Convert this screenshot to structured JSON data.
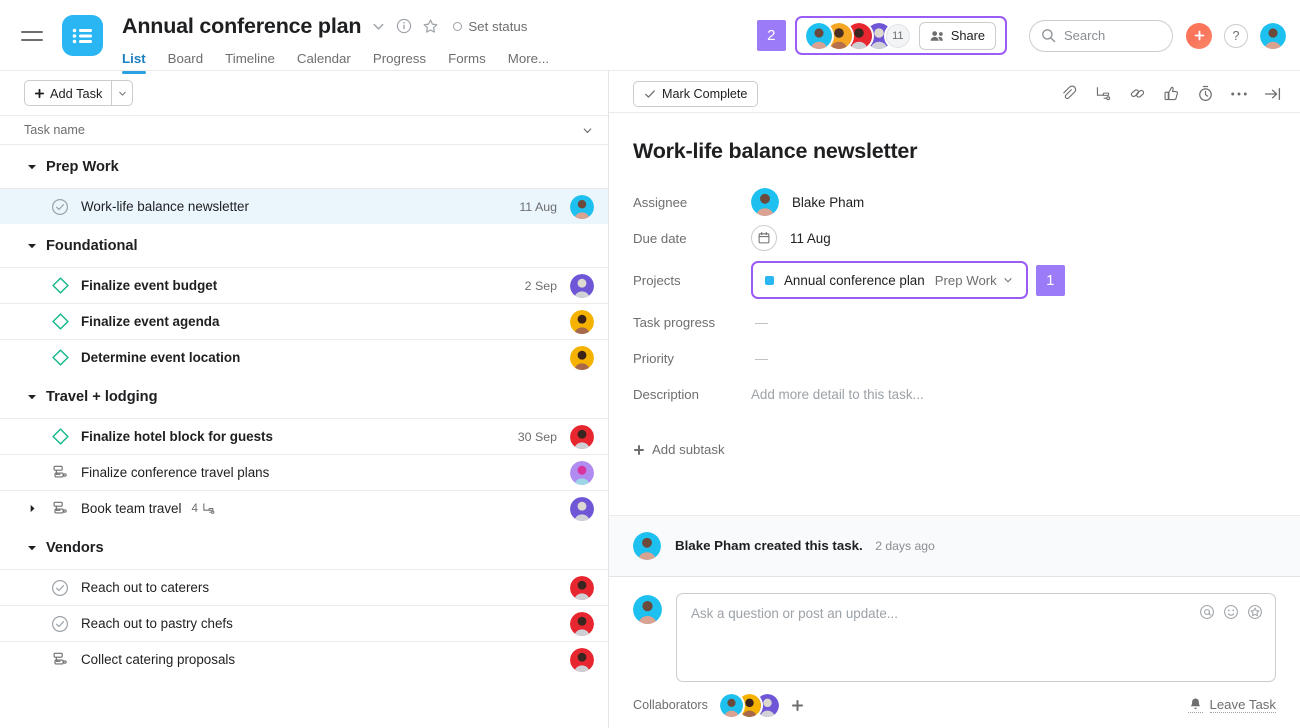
{
  "topbar": {
    "menu_icon": "hamburger-icon",
    "project_logo_icon": "project-list-logo-icon",
    "project_title": "Annual conference plan",
    "chevron_icon": "chevron-down-icon",
    "info_icon": "info-circle-icon",
    "star_icon": "star-outline-icon",
    "set_status_label": "Set status",
    "tabs": [
      {
        "label": "List",
        "active": true
      },
      {
        "label": "Board",
        "active": false
      },
      {
        "label": "Timeline",
        "active": false
      },
      {
        "label": "Calendar",
        "active": false
      },
      {
        "label": "Progress",
        "active": false
      },
      {
        "label": "Forms",
        "active": false
      },
      {
        "label": "More...",
        "active": false
      }
    ],
    "annotation_badge": "2",
    "members_overflow_count": "11",
    "share_label": "Share",
    "share_icon": "people-icon",
    "search_placeholder": "Search",
    "search_value": "",
    "search_icon": "search-icon",
    "plus_icon": "plus-icon",
    "help_label": "?",
    "avatars": [
      {
        "name": "member-1",
        "color": "#1ec0f0"
      },
      {
        "name": "member-2",
        "color": "#f5a623"
      },
      {
        "name": "member-3",
        "color": "#e8262f"
      },
      {
        "name": "member-4",
        "color": "#6f56d6"
      }
    ],
    "account_avatar_color": "#1ec0f0"
  },
  "list": {
    "add_task_label": "Add Task",
    "add_task_caret_icon": "chevron-down-icon",
    "column_header": "Task name",
    "column_caret_icon": "chevron-down-icon",
    "sections": [
      {
        "title": "Prep Work",
        "tasks": [
          {
            "name": "Work-life balance newsletter",
            "icon": "check-circle-icon",
            "bold": false,
            "date": "11 Aug",
            "avatar_color": "#1ec0f0",
            "selected": true,
            "expandable": false,
            "subtask_count": ""
          }
        ]
      },
      {
        "title": "Foundational",
        "tasks": [
          {
            "name": "Finalize event budget",
            "icon": "milestone-diamond-icon",
            "bold": true,
            "date": "2 Sep",
            "avatar_color": "#6f56d6",
            "selected": false,
            "expandable": false,
            "subtask_count": ""
          },
          {
            "name": "Finalize event agenda",
            "icon": "milestone-diamond-icon",
            "bold": true,
            "date": "",
            "avatar_color": "#f5b300",
            "selected": false,
            "expandable": false,
            "subtask_count": ""
          },
          {
            "name": "Determine event location",
            "icon": "milestone-diamond-icon",
            "bold": true,
            "date": "",
            "avatar_color": "#f5b300",
            "selected": false,
            "expandable": false,
            "subtask_count": ""
          }
        ]
      },
      {
        "title": "Travel + lodging",
        "tasks": [
          {
            "name": "Finalize hotel block for guests",
            "icon": "milestone-diamond-icon",
            "bold": true,
            "date": "30 Sep",
            "avatar_color": "#e8262f",
            "selected": false,
            "expandable": false,
            "subtask_count": ""
          },
          {
            "name": "Finalize conference travel plans",
            "icon": "subtask-icon",
            "bold": false,
            "date": "",
            "avatar_color": "#b18cf0",
            "selected": false,
            "expandable": false,
            "subtask_count": ""
          },
          {
            "name": "Book team travel",
            "icon": "subtask-icon",
            "bold": false,
            "date": "",
            "avatar_color": "#6f56d6",
            "selected": false,
            "expandable": true,
            "subtask_count": "4"
          }
        ]
      },
      {
        "title": "Vendors",
        "tasks": [
          {
            "name": "Reach out to caterers",
            "icon": "check-circle-icon",
            "bold": false,
            "date": "",
            "avatar_color": "#e8262f",
            "selected": false,
            "expandable": false,
            "subtask_count": ""
          },
          {
            "name": "Reach out to pastry chefs",
            "icon": "check-circle-icon",
            "bold": false,
            "date": "",
            "avatar_color": "#e8262f",
            "selected": false,
            "expandable": false,
            "subtask_count": ""
          },
          {
            "name": "Collect catering proposals",
            "icon": "subtask-icon",
            "bold": false,
            "date": "",
            "avatar_color": "#e8262f",
            "selected": false,
            "expandable": false,
            "subtask_count": ""
          }
        ]
      }
    ]
  },
  "detail": {
    "mark_complete_label": "Mark Complete",
    "toolbar_icons": [
      "attachment-paperclip-icon",
      "add-subtask-icon",
      "copy-link-icon",
      "like-thumbs-up-icon",
      "timer-icon",
      "more-ellipsis-icon",
      "collapse-right-icon"
    ],
    "task_title": "Work-life balance newsletter",
    "fields": {
      "assignee_label": "Assignee",
      "assignee_name": "Blake Pham",
      "assignee_avatar_color": "#1ec0f0",
      "due_date_label": "Due date",
      "due_date_value": "11 Aug",
      "due_date_icon": "calendar-icon",
      "projects_label": "Projects",
      "project_name": "Annual conference plan",
      "project_color": "#29b6f2",
      "project_section": "Prep Work",
      "project_section_caret_icon": "chevron-down-icon",
      "annotation_badge": "1",
      "task_progress_label": "Task progress",
      "task_progress_value": "—",
      "priority_label": "Priority",
      "priority_value": "—",
      "description_label": "Description",
      "description_placeholder": "Add more detail to this task..."
    },
    "add_subtask_label": "Add subtask",
    "activity": {
      "avatar_color": "#1ec0f0",
      "text": "Blake Pham created this task.",
      "time": "2 days ago"
    },
    "composer": {
      "avatar_color": "#1ec0f0",
      "placeholder": "Ask a question or post an update...",
      "value": "",
      "icons": [
        "mention-at-icon",
        "emoji-smiley-icon",
        "sticker-star-icon"
      ]
    },
    "footer": {
      "collaborators_label": "Collaborators",
      "collaborator_avatars": [
        {
          "name": "collaborator-1",
          "color": "#1ec0f0"
        },
        {
          "name": "collaborator-2",
          "color": "#f5b300"
        },
        {
          "name": "collaborator-3",
          "color": "#6f56d6"
        }
      ],
      "add_collaborator_icon": "plus-icon",
      "leave_task_label": "Leave Task",
      "leave_task_icon": "bell-icon"
    }
  },
  "colors": {
    "accent_blue": "#29b6f2",
    "tab_active": "#1a7fc1",
    "annotation_purple": "#9b5cf6",
    "badge_purple": "#9b7bf7",
    "milestone_teal": "#14b88a",
    "selected_row": "#eaf5fc"
  }
}
